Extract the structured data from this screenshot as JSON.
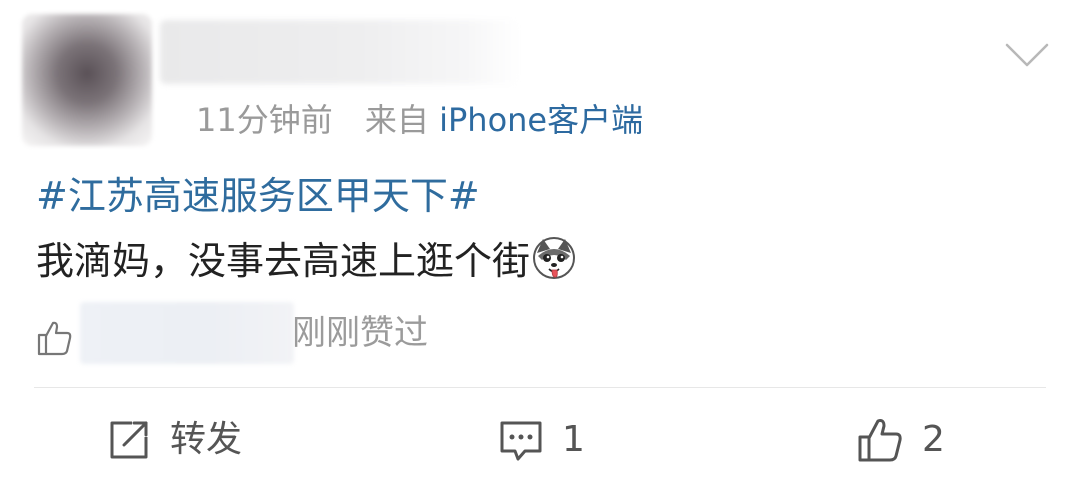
{
  "post": {
    "time": "11分钟前",
    "source_prefix": "来自",
    "source_client": "iPhone客户端",
    "topic": "#江苏高速服务区甲天下#",
    "text": "我滴妈，没事去高速上逛个街"
  },
  "likes_row": {
    "text": "刚刚赞过"
  },
  "actions": {
    "repost_label": "转发",
    "comment_count": "1",
    "like_count": "2"
  },
  "icons": {
    "menu": "chevron-down-icon",
    "thumbs_up": "thumbs-up-icon",
    "repost": "share-out-icon",
    "comment": "comment-bubble-icon",
    "emoji": "husky-emoji-icon"
  },
  "colors": {
    "link": "#2f6c9e",
    "meta": "#9a9a9a",
    "text": "#222222",
    "divider": "#e7e7e7"
  }
}
